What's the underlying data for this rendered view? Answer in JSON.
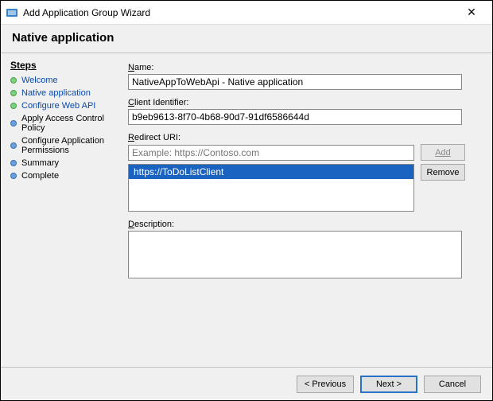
{
  "window": {
    "title": "Add Application Group Wizard",
    "close": "✕"
  },
  "header": {
    "title": "Native application"
  },
  "steps_title": "Steps",
  "steps": [
    {
      "label": "Welcome",
      "state": "done",
      "link": true
    },
    {
      "label": "Native application",
      "state": "done",
      "link": true
    },
    {
      "label": "Configure Web API",
      "state": "done",
      "link": true
    },
    {
      "label": "Apply Access Control Policy",
      "state": "todo",
      "link": false
    },
    {
      "label": "Configure Application Permissions",
      "state": "todo",
      "link": false
    },
    {
      "label": "Summary",
      "state": "todo",
      "link": false
    },
    {
      "label": "Complete",
      "state": "todo",
      "link": false
    }
  ],
  "form": {
    "name_label": "Name:",
    "name_value": "NativeAppToWebApi - Native application",
    "cid_label": "Client Identifier:",
    "cid_value": "b9eb9613-8f70-4b68-90d7-91df6586644d",
    "uri_label": "Redirect URI:",
    "uri_placeholder": "Example: https://Contoso.com",
    "add_label": "Add",
    "remove_label": "Remove",
    "redirect_uris": [
      "https://ToDoListClient"
    ],
    "desc_label": "Description:",
    "desc_value": ""
  },
  "footer": {
    "previous": "< Previous",
    "next": "Next >",
    "cancel": "Cancel"
  }
}
